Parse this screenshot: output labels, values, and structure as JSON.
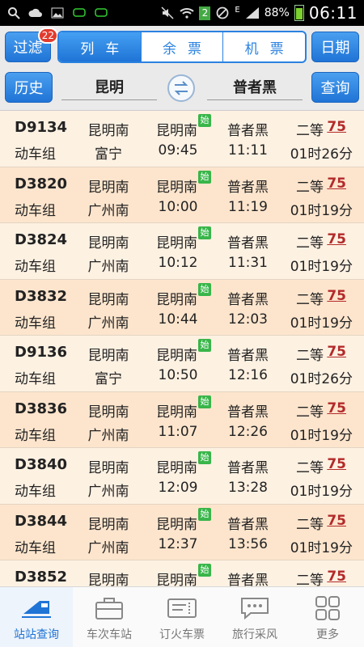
{
  "status_bar": {
    "battery": "88%",
    "time": "06:11",
    "sim_badge": "2",
    "net": "E"
  },
  "header": {
    "filter_label": "过滤",
    "filter_badge": "22",
    "tabs": [
      "列车",
      "余票",
      "机票"
    ],
    "date_label": "日期",
    "history_label": "历史",
    "from_city": "昆明",
    "to_city": "普者黑",
    "search_label": "查询",
    "swap_icon": "swap-arrows-icon"
  },
  "start_badge": "始",
  "trains": [
    {
      "no": "D9134",
      "type": "动车组",
      "from": "昆明南",
      "origin": "富宁",
      "dep_station": "昆明南",
      "dep_time": "09:45",
      "to": "普者黑",
      "arr_time": "11:11",
      "class": "二等",
      "price": "75",
      "duration": "01时26分"
    },
    {
      "no": "D3820",
      "type": "动车组",
      "from": "昆明南",
      "origin": "广州南",
      "dep_station": "昆明南",
      "dep_time": "10:00",
      "to": "普者黑",
      "arr_time": "11:19",
      "class": "二等",
      "price": "75",
      "duration": "01时19分"
    },
    {
      "no": "D3824",
      "type": "动车组",
      "from": "昆明南",
      "origin": "广州南",
      "dep_station": "昆明南",
      "dep_time": "10:12",
      "to": "普者黑",
      "arr_time": "11:31",
      "class": "二等",
      "price": "75",
      "duration": "01时19分"
    },
    {
      "no": "D3832",
      "type": "动车组",
      "from": "昆明南",
      "origin": "广州南",
      "dep_station": "昆明南",
      "dep_time": "10:44",
      "to": "普者黑",
      "arr_time": "12:03",
      "class": "二等",
      "price": "75",
      "duration": "01时19分"
    },
    {
      "no": "D9136",
      "type": "动车组",
      "from": "昆明南",
      "origin": "富宁",
      "dep_station": "昆明南",
      "dep_time": "10:50",
      "to": "普者黑",
      "arr_time": "12:16",
      "class": "二等",
      "price": "75",
      "duration": "01时26分"
    },
    {
      "no": "D3836",
      "type": "动车组",
      "from": "昆明南",
      "origin": "广州南",
      "dep_station": "昆明南",
      "dep_time": "11:07",
      "to": "普者黑",
      "arr_time": "12:26",
      "class": "二等",
      "price": "75",
      "duration": "01时19分"
    },
    {
      "no": "D3840",
      "type": "动车组",
      "from": "昆明南",
      "origin": "广州南",
      "dep_station": "昆明南",
      "dep_time": "12:09",
      "to": "普者黑",
      "arr_time": "13:28",
      "class": "二等",
      "price": "75",
      "duration": "01时19分"
    },
    {
      "no": "D3844",
      "type": "动车组",
      "from": "昆明南",
      "origin": "广州南",
      "dep_station": "昆明南",
      "dep_time": "12:37",
      "to": "普者黑",
      "arr_time": "13:56",
      "class": "二等",
      "price": "75",
      "duration": "01时19分"
    },
    {
      "no": "D3852",
      "type": "",
      "from": "昆明南",
      "origin": "",
      "dep_station": "昆明南",
      "dep_time": "",
      "to": "普者黑",
      "arr_time": "",
      "class": "二等",
      "price": "75",
      "duration": ""
    }
  ],
  "tabbar": [
    {
      "label": "站站查询",
      "icon": "train-icon",
      "active": true
    },
    {
      "label": "车次车站",
      "icon": "briefcase-icon",
      "active": false
    },
    {
      "label": "订火车票",
      "icon": "ticket-icon",
      "active": false
    },
    {
      "label": "旅行采风",
      "icon": "chat-bubble-icon",
      "active": false
    },
    {
      "label": "更多",
      "icon": "grid-icon",
      "active": false
    }
  ],
  "colors": {
    "accent": "#1f74d6",
    "row_light": "#fdf1e2",
    "row_dark": "#fde5cd",
    "price": "#b32a2a",
    "start_badge": "#39b54a"
  }
}
